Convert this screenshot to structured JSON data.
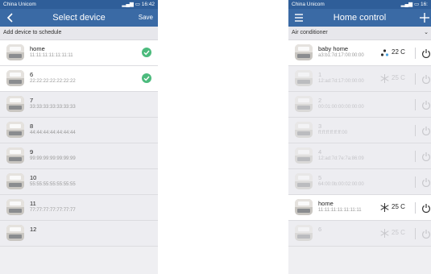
{
  "status": {
    "carrier": "China Unicom",
    "time_left": "16:42",
    "time_right": "16:"
  },
  "left": {
    "title": "Select device",
    "save_label": "Save",
    "header": "Add device to schedule",
    "devices": [
      {
        "name": "home",
        "mac": "11:11:11:11:11:11:11",
        "checked": true
      },
      {
        "name": "6",
        "mac": "22:22:22:22:22:22:22",
        "checked": true
      },
      {
        "name": "7",
        "mac": "33:33:33:33:33:33:33",
        "checked": false
      },
      {
        "name": "8",
        "mac": "44:44:44:44:44:44:44",
        "checked": false
      },
      {
        "name": "9",
        "mac": "99:99:99:99:99:99:99",
        "checked": false
      },
      {
        "name": "10",
        "mac": "55:55:55:55:55:55:55",
        "checked": false
      },
      {
        "name": "11",
        "mac": "77:77:77:77:77:77:77",
        "checked": false
      },
      {
        "name": "12",
        "mac": "",
        "checked": false
      }
    ]
  },
  "right": {
    "title": "Home control",
    "section": "Air conditioner",
    "devices": [
      {
        "name": "baby home",
        "mac": "a3:b1:7d:17:00:00:00",
        "temp": "22 C",
        "mode": "fan",
        "online": true
      },
      {
        "name": "1",
        "mac": "12:ad:7d:17:00:00:00",
        "temp": "25 C",
        "mode": "cool",
        "online": false
      },
      {
        "name": "2",
        "mac": "00:01:00:00:00:00:00",
        "temp": "",
        "mode": "",
        "online": false
      },
      {
        "name": "3",
        "mac": "ff:ff:ff:ff:ff:ff:00",
        "temp": "",
        "mode": "",
        "online": false
      },
      {
        "name": "4",
        "mac": "12:ad:7d:7e:7a:86:09",
        "temp": "",
        "mode": "",
        "online": false
      },
      {
        "name": "5",
        "mac": "64:00:0b:00:02:00:00",
        "temp": "",
        "mode": "",
        "online": false
      },
      {
        "name": "home",
        "mac": "11:11:11:11:11:11:11",
        "temp": "25 C",
        "mode": "cool",
        "online": true
      },
      {
        "name": "6",
        "mac": "",
        "temp": "25 C",
        "mode": "cool",
        "online": false
      }
    ]
  },
  "colors": {
    "status_bar": "#2f5e99",
    "app_bar": "#3a6aa5",
    "check": "#4cbb7d"
  }
}
